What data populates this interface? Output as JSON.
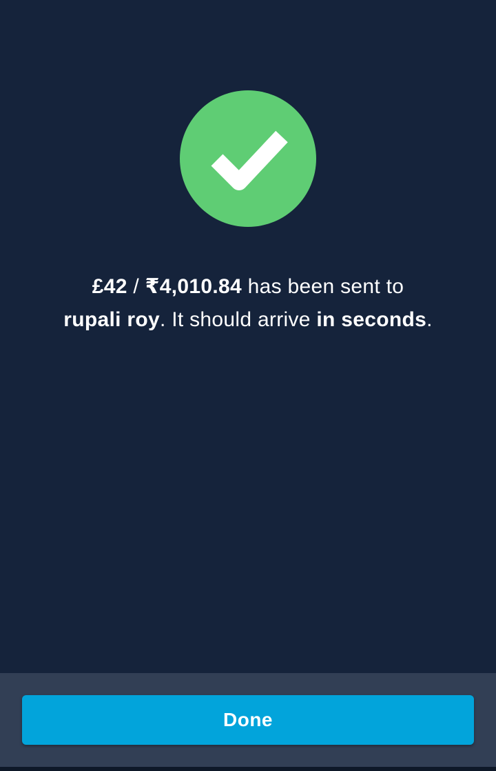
{
  "status": {
    "icon": "checkmark-icon",
    "circle_color": "#5fcd74"
  },
  "message": {
    "amount_source": "£42",
    "separator": " / ",
    "amount_target": "₹4,010.84",
    "text_sent": " has been sent to",
    "recipient": "rupali roy",
    "text_arrive": ". It should arrive ",
    "eta": "in seconds",
    "text_end": "."
  },
  "footer": {
    "done_label": "Done",
    "button_color": "#02a4db"
  }
}
